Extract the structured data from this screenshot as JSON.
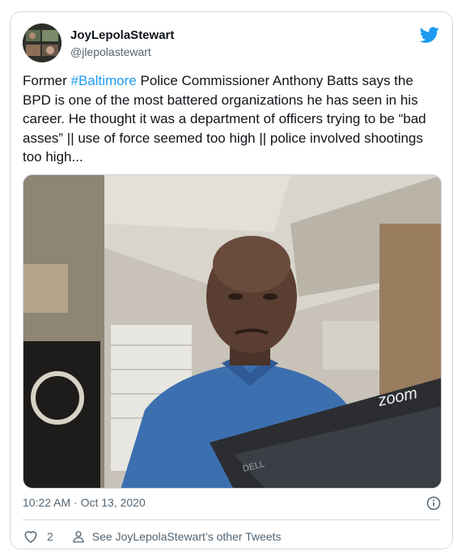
{
  "user": {
    "display_name": "JoyLepolaStewart",
    "handle": "@jlepolastewart"
  },
  "tweet": {
    "text_before": "Former ",
    "hashtag": "#Baltimore",
    "text_after": " Police Commissioner Anthony Batts says the BPD is one of the most battered organizations he has seen in his career. He thought it was a department of officers trying to be “bad asses” || use of force seemed too high || police involved shootings too high..."
  },
  "media": {
    "watermark": "zoom",
    "laptop_brand": "DELL"
  },
  "footer": {
    "timestamp": "10:22 AM · Oct 13, 2020",
    "like_count": "2",
    "other_tweets_label": "See JoyLepolaStewart’s other Tweets"
  },
  "icons": {
    "brand": "twitter-bird-icon",
    "info": "info-icon",
    "like": "heart-icon",
    "profile": "person-icon"
  },
  "colors": {
    "accent": "#1d9bf0",
    "text": "#0f1419",
    "secondary": "#536471",
    "border": "#cfd9de"
  }
}
